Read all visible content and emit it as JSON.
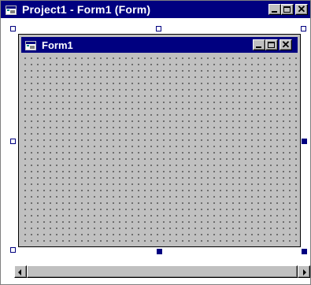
{
  "outer_window": {
    "title": "Project1 - Form1 (Form)",
    "title_color": "#000080",
    "icon": "form-window-icon"
  },
  "form_window": {
    "title": "Form1",
    "background_color": "#c0c0c0",
    "icon": "form-window-icon"
  },
  "caption_buttons": {
    "minimize_icon": "minimize-icon",
    "maximize_icon": "maximize-icon",
    "close_glyph": "✕"
  },
  "handle_colors": {
    "selected": "#000080"
  }
}
